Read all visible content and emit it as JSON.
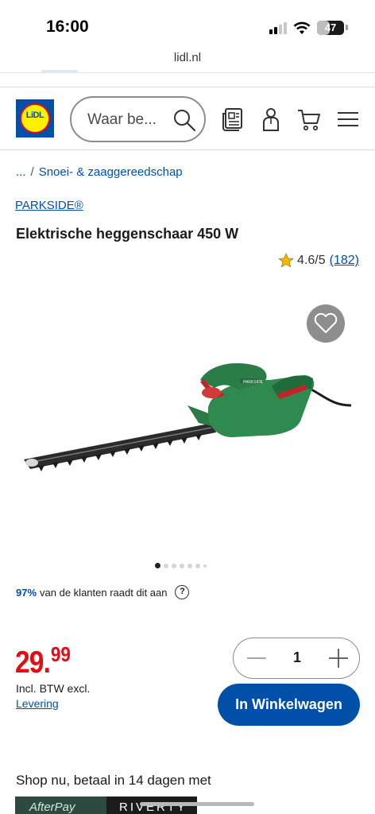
{
  "status_bar": {
    "time": "16:00",
    "battery": "47",
    "battery_fraction": 0.47
  },
  "browser": {
    "url": "lidl.nl"
  },
  "header": {
    "logo_text": "LiDL",
    "search_placeholder": "Waar be...",
    "icons": [
      "search-icon",
      "leaflet-icon",
      "account-icon",
      "cart-icon",
      "menu-icon"
    ]
  },
  "breadcrumb": {
    "ellipsis": "...",
    "separator": "/",
    "category": "Snoei- & zaaggereedschap"
  },
  "product": {
    "brand": "PARKSIDE®",
    "title": "Elektrische heggenschaar 450 W",
    "rating": "4.6/5",
    "rating_value": 4.6,
    "review_count": "(182)",
    "image_index": 1,
    "image_count": 8
  },
  "recommend": {
    "percent": "97%",
    "text": "van de klanten raadt dit aan",
    "help": "?"
  },
  "price": {
    "integer": "29.",
    "cents": "99",
    "tax_note": "Incl. BTW excl.",
    "delivery_link": "Levering"
  },
  "quantity": {
    "value": "1"
  },
  "cart_button": {
    "label": "In Winkelwagen"
  },
  "payment": {
    "title": "Shop nu, betaal in 14 dagen met",
    "providers": [
      "AfterPay",
      "RIVERTY"
    ]
  },
  "colors": {
    "brand_blue": "#0050aa",
    "price_red": "#e60a14",
    "tool_green": "#2e8a4e",
    "star": "#f5b800"
  }
}
